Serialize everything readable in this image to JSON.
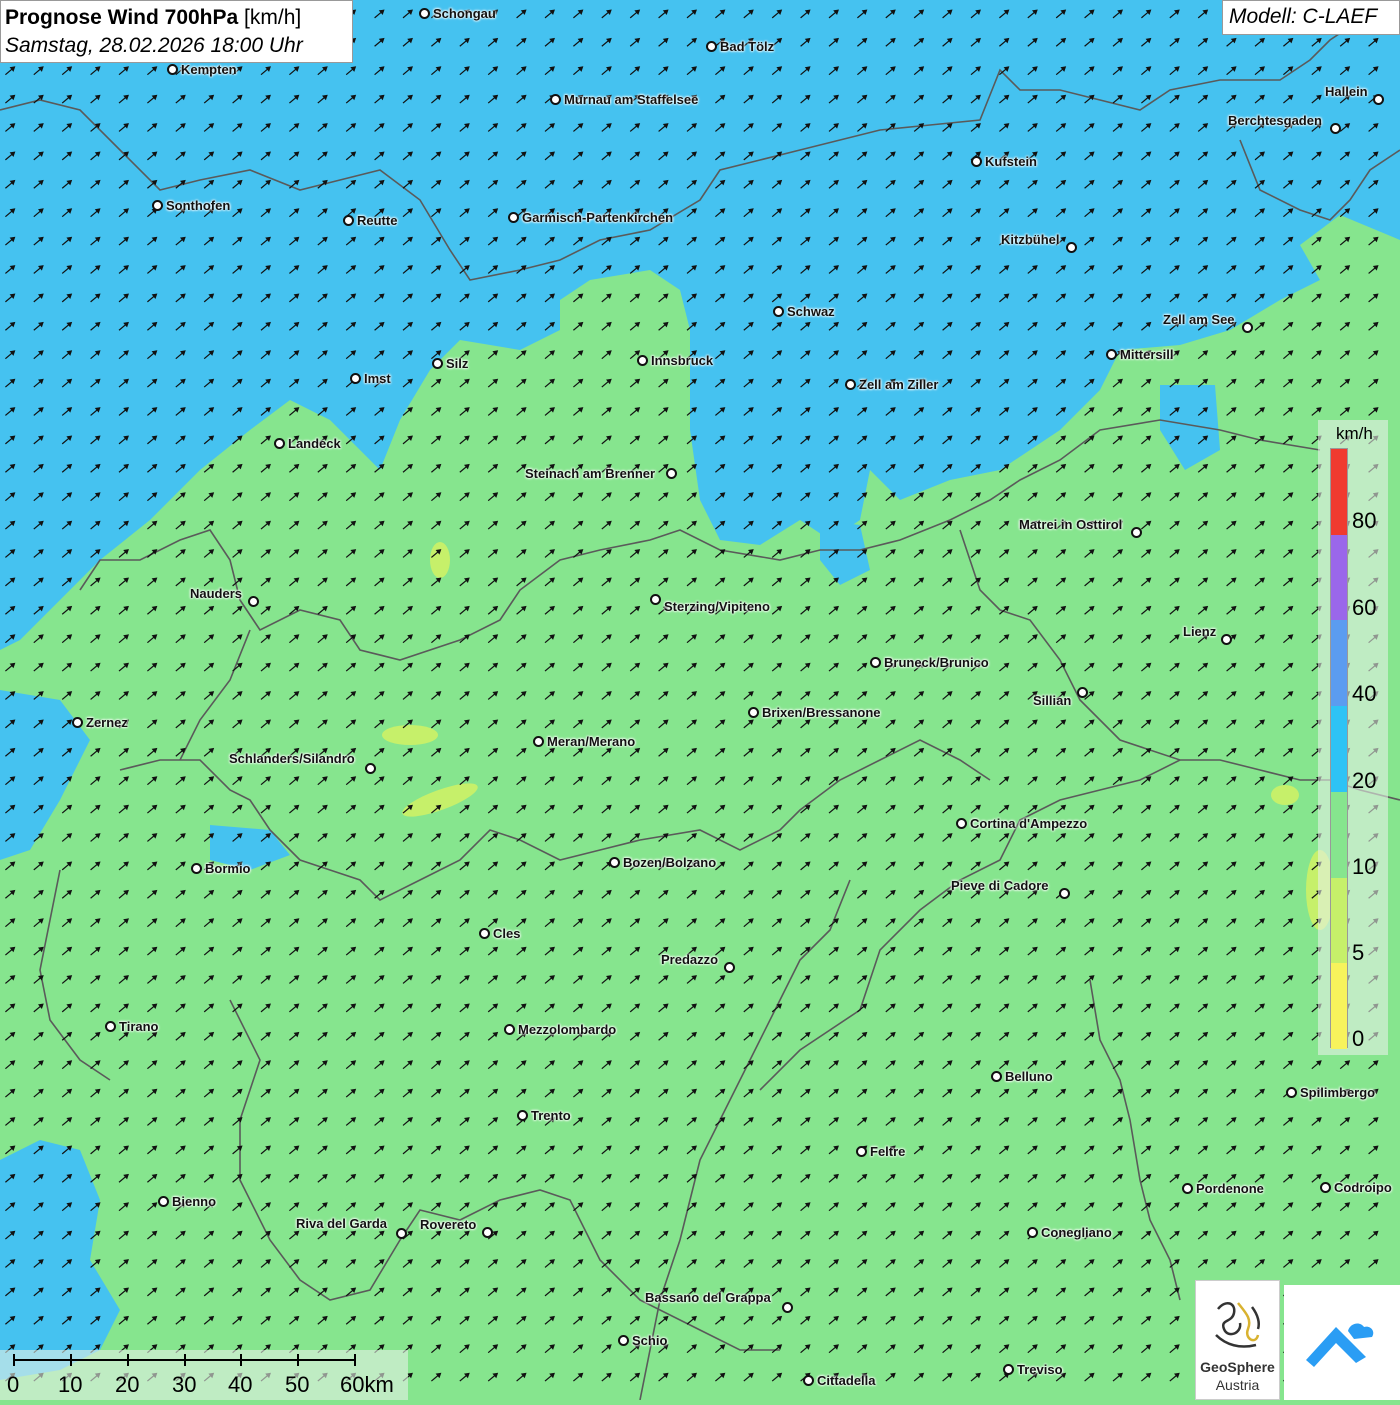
{
  "header": {
    "title_bold": "Prognose Wind 700hPa",
    "title_unit": "[km/h]",
    "datetime": "Samstag, 28.02.2026 18:00 Uhr",
    "model": "Modell: C-LAEF"
  },
  "legend": {
    "unit": "km/h",
    "labels": [
      "80",
      "60",
      "40",
      "20",
      "10",
      "5",
      "0"
    ],
    "colors": [
      "#f03a2f",
      "#9a67ea",
      "#5b9cf0",
      "#2ec3f5",
      "#86e58e",
      "#c6f06a",
      "#f7f35c"
    ]
  },
  "scale_bar": {
    "labels": [
      "0",
      "10",
      "20",
      "30",
      "40",
      "50",
      "60km"
    ]
  },
  "colors": {
    "calm_zone": "#86e58e",
    "wind_zone": "#45c2f0",
    "border": "#5a5a5a",
    "arrow": "#111111"
  },
  "cities": [
    {
      "name": "Schongau"
    },
    {
      "name": "Bad Tölz"
    },
    {
      "name": "Kempten"
    },
    {
      "name": "Murnau am Staffelsee"
    },
    {
      "name": "Hallein"
    },
    {
      "name": "Berchtesgaden"
    },
    {
      "name": "Kufstein"
    },
    {
      "name": "Sonthofen"
    },
    {
      "name": "Reutte"
    },
    {
      "name": "Garmisch-Partenkirchen"
    },
    {
      "name": "Kitzbühel"
    },
    {
      "name": "Schwaz"
    },
    {
      "name": "Zell am See"
    },
    {
      "name": "Mittersill"
    },
    {
      "name": "Innsbruck"
    },
    {
      "name": "Imst"
    },
    {
      "name": "Silz"
    },
    {
      "name": "Zell am Ziller"
    },
    {
      "name": "Landeck"
    },
    {
      "name": "Steinach am Brenner"
    },
    {
      "name": "Matrei in Osttirol"
    },
    {
      "name": "Nauders"
    },
    {
      "name": "Sterzing/Vipiteno"
    },
    {
      "name": "Lienz"
    },
    {
      "name": "Bruneck/Brunico"
    },
    {
      "name": "Sillian"
    },
    {
      "name": "Brixen/Bressanone"
    },
    {
      "name": "Zernez"
    },
    {
      "name": "Meran/Merano"
    },
    {
      "name": "Schlanders/Silandro"
    },
    {
      "name": "Cortina d'Ampezzo"
    },
    {
      "name": "Bozen/Bolzano"
    },
    {
      "name": "Bormio"
    },
    {
      "name": "Pieve di Cadore"
    },
    {
      "name": "Cles"
    },
    {
      "name": "Predazzo"
    },
    {
      "name": "Tirano"
    },
    {
      "name": "Mezzolombardo"
    },
    {
      "name": "Belluno"
    },
    {
      "name": "Spilimbergo"
    },
    {
      "name": "Trento"
    },
    {
      "name": "Feltre"
    },
    {
      "name": "Pordenone"
    },
    {
      "name": "Codroipo"
    },
    {
      "name": "Bienno"
    },
    {
      "name": "Riva del Garda"
    },
    {
      "name": "Rovereto"
    },
    {
      "name": "Conegliano"
    },
    {
      "name": "Bassano del Grappa"
    },
    {
      "name": "Schio"
    },
    {
      "name": "Treviso"
    },
    {
      "name": "Cittadella"
    }
  ],
  "logos": {
    "geosphere_line1": "GeoSphere",
    "geosphere_line2": "Austria"
  }
}
